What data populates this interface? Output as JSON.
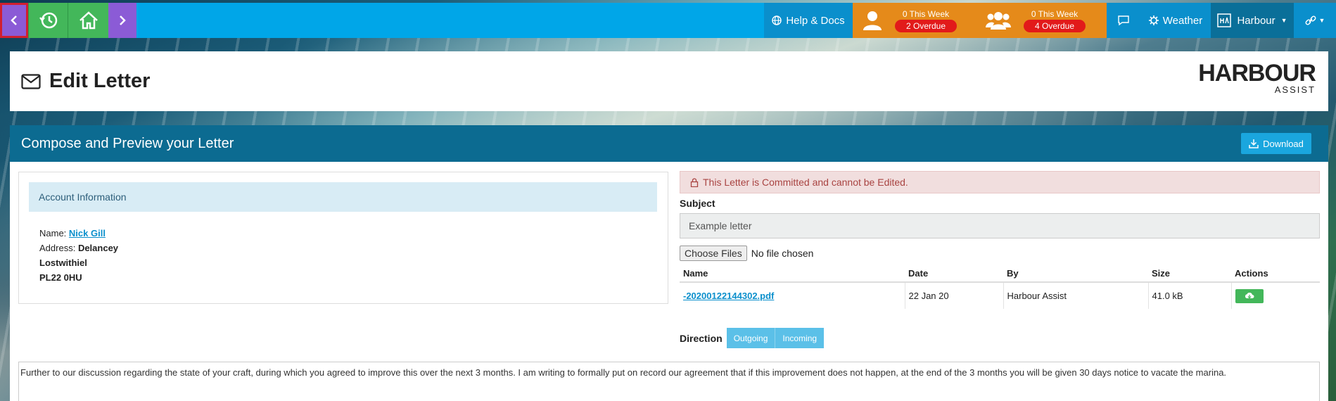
{
  "topbar": {
    "help_label": "Help & Docs",
    "stat1": {
      "week": "0 This Week",
      "overdue": "2 Overdue"
    },
    "stat2": {
      "week": "0 This Week",
      "overdue": "4 Overdue"
    },
    "weather_label": "Weather",
    "harbour_label": "Harbour",
    "colors": {
      "bar": "#00a6e8",
      "nav_purple": "#8b5bd6",
      "nav_green": "#43b75a",
      "stat_orange": "#e58a1a",
      "overdue_red": "#e21a1a"
    },
    "icons": [
      "back-chevron-icon",
      "history-icon",
      "home-icon",
      "forward-chevron-icon",
      "globe-icon",
      "user-icon",
      "users-icon",
      "chat-icon",
      "gear-icon",
      "harbour-icon",
      "link-icon"
    ]
  },
  "header": {
    "title": "Edit Letter",
    "logo_main": "HARBOUR",
    "logo_sub": "ASSIST"
  },
  "panel": {
    "title": "Compose and Preview your Letter",
    "download_label": "Download"
  },
  "account": {
    "heading": "Account Information",
    "name_label": "Name:",
    "name_value": "Nick Gill",
    "address_label": "Address:",
    "address_line1": "Delancey",
    "address_line2": "Lostwithiel",
    "address_line3": "PL22 0HU"
  },
  "letter": {
    "alert": "This Letter is Committed and cannot be Edited.",
    "subject_label": "Subject",
    "subject_value": "Example letter",
    "choose_files_label": "Choose Files",
    "no_file_text": "No file chosen",
    "table": {
      "headers": [
        "Name",
        "Date",
        "By",
        "Size",
        "Actions"
      ],
      "rows": [
        {
          "name": "-20200122144302.pdf",
          "date": "22 Jan 20",
          "by": "Harbour Assist",
          "size": "41.0 kB"
        }
      ]
    },
    "direction_label": "Direction",
    "direction_options": [
      "Outgoing",
      "Incoming"
    ],
    "body": "Further to our discussion regarding the state of your craft, during which you agreed to improve this over the next 3 months.  I am writing to formally put on record our agreement that if this improvement does not happen, at the end of the 3 months you will be given 30 days notice to vacate the marina."
  }
}
